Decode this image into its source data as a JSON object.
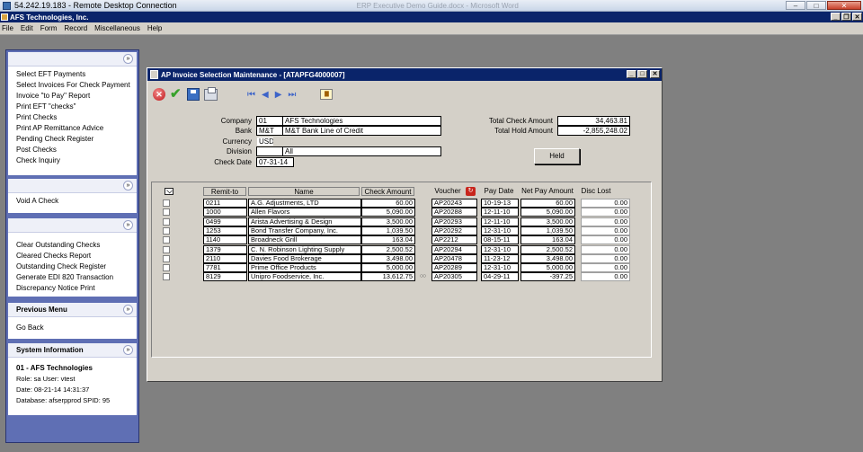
{
  "rdp": {
    "title": "54.242.19.183 - Remote Desktop Connection",
    "background_tab": "ERP Executive Demo Guide.docx - Microsoft Word",
    "min_glyph": "–",
    "max_glyph": "□",
    "close_glyph": "✕"
  },
  "app": {
    "title": "AFS Technologies, Inc.",
    "min_glyph": "_",
    "restore_glyph": "❐",
    "close_glyph": "✕"
  },
  "menu": [
    "File",
    "Edit",
    "Form",
    "Record",
    "Miscellaneous",
    "Help"
  ],
  "sidebar": {
    "collapse_glyph": "»",
    "group1": [
      "Select EFT Payments",
      "Select Invoices For Check Payment",
      "Invoice \"to Pay\" Report",
      "Print EFT \"checks\"",
      "Print Checks",
      "Print AP Remittance Advice",
      "Pending Check Register",
      "Post Checks",
      "Check Inquiry"
    ],
    "group2": [
      "Void A Check"
    ],
    "group3": [
      "Clear Outstanding Checks",
      "Cleared Checks Report",
      "Outstanding Check Register",
      "Generate EDI 820 Transaction",
      "Discrepancy Notice Print"
    ],
    "previous_menu": {
      "title": "Previous Menu",
      "link": "Go Back"
    },
    "system_info": {
      "title": "System Information",
      "company": "01 - AFS Technologies",
      "role_line": "Role: sa  User: vtest",
      "date_line": "Date: 08-21-14 14:31:37",
      "db_line": "Database: afserpprod  SPID: 95"
    }
  },
  "window": {
    "title": "AP Invoice Selection Maintenance - [ATAPFG4000007]",
    "min_glyph": "_",
    "max_glyph": "□",
    "close_glyph": "✕"
  },
  "toolbar": {
    "cancel_glyph": "✕",
    "ok_glyph": "✔",
    "first_glyph": "⏮",
    "prev_glyph": "◀",
    "next_glyph": "▶",
    "last_glyph": "⏭",
    "memo_glyph": "▇"
  },
  "header": {
    "company_label": "Company",
    "company_code": "01",
    "company_name": "AFS Technologies",
    "bank_label": "Bank",
    "bank_code": "M&T",
    "bank_name": "M&T Bank Line of Credit",
    "currency_label": "Currency",
    "currency": "USD",
    "division_label": "Division",
    "division_code": "",
    "division_name": "All",
    "check_date_label": "Check Date",
    "check_date": "07-31-14",
    "total_check_label": "Total Check Amount",
    "total_check": "34,463.81",
    "total_hold_label": "Total Hold Amount",
    "total_hold": "-2,855,248.02",
    "held_button": "Held"
  },
  "grid": {
    "columns": [
      "Remit-to",
      "Name",
      "Check Amount",
      "Voucher",
      "Pay Date",
      "Net Pay Amount",
      "Disc Lost"
    ],
    "voucher_icon_glyph": "↻",
    "ellipsis_glyph": "○○",
    "rows": [
      {
        "remit": "0211",
        "name": "A.G. Adjustments, LTD",
        "check": "60.00",
        "voucher": "AP20243",
        "pay_date": "10-19-13",
        "net": "60.00",
        "disc": "0.00"
      },
      {
        "remit": "1000",
        "name": "Allen Flavors",
        "check": "5,090.00",
        "voucher": "AP20288",
        "pay_date": "12-11-10",
        "net": "5,090.00",
        "disc": "0.00"
      },
      {
        "remit": "0499",
        "name": "Arista Advertising & Design",
        "check": "3,500.00",
        "voucher": "AP20293",
        "pay_date": "12-11-10",
        "net": "3,500.00",
        "disc": "0.00"
      },
      {
        "remit": "1253",
        "name": "Bond Transfer Company, Inc.",
        "check": "1,039.50",
        "voucher": "AP20292",
        "pay_date": "12-31-10",
        "net": "1,039.50",
        "disc": "0.00"
      },
      {
        "remit": "1140",
        "name": "Broadneck Grill",
        "check": "163.04",
        "voucher": "AP2212",
        "pay_date": "08-15-11",
        "net": "163.04",
        "disc": "0.00"
      },
      {
        "remit": "1379",
        "name": "C. N. Robinson Lighting Supply",
        "check": "2,500.52",
        "voucher": "AP20294",
        "pay_date": "12-31-10",
        "net": "2,500.52",
        "disc": "0.00"
      },
      {
        "remit": "2110",
        "name": "Davies Food Brokerage",
        "check": "3,498.00",
        "voucher": "AP20478",
        "pay_date": "11-23-12",
        "net": "3,498.00",
        "disc": "0.00"
      },
      {
        "remit": "7781",
        "name": "Prime Office Products",
        "check": "5,000.00",
        "voucher": "AP20289",
        "pay_date": "12-31-10",
        "net": "5,000.00",
        "disc": "0.00"
      },
      {
        "remit": "8129",
        "name": "Unipro Foodservice, Inc.",
        "check": "13,612.75",
        "voucher": "AP20305",
        "pay_date": "04-29-11",
        "net": "-397.25",
        "disc": "0.00"
      }
    ]
  }
}
